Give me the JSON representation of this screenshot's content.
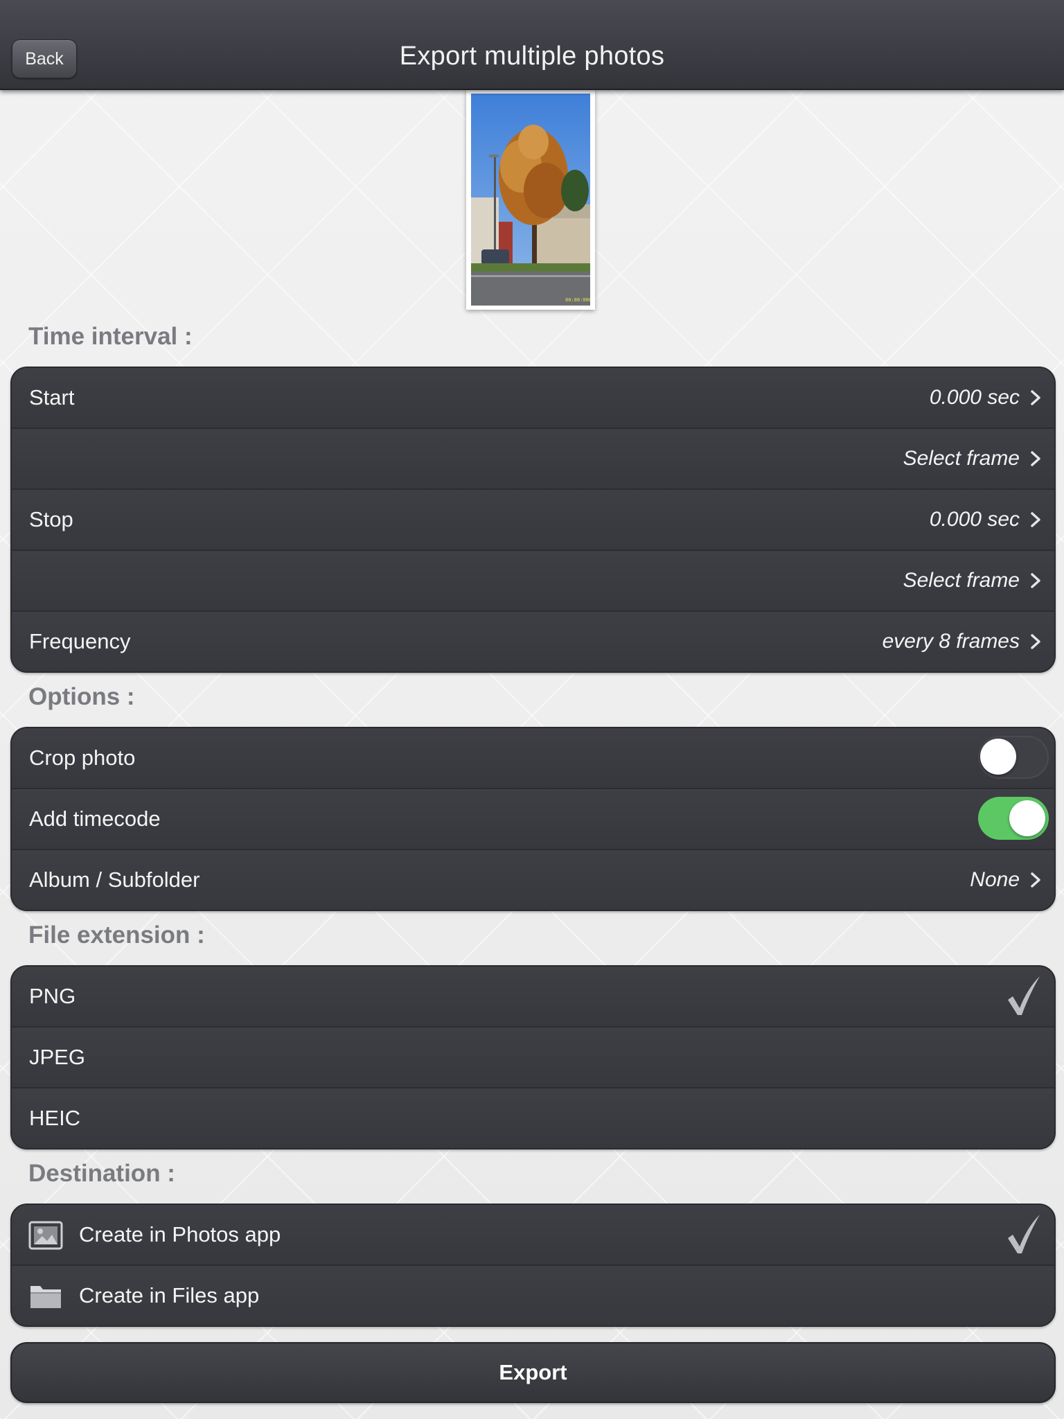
{
  "header": {
    "title": "Export multiple photos",
    "back_label": "Back"
  },
  "sections": {
    "time_interval": "Time interval :",
    "options": "Options :",
    "file_extension": "File extension :",
    "destination": "Destination :"
  },
  "time_interval": {
    "start_label": "Start",
    "start_value": "0.000 sec",
    "start_frame": "Select frame",
    "stop_label": "Stop",
    "stop_value": "0.000 sec",
    "stop_frame": "Select frame",
    "frequency_label": "Frequency",
    "frequency_value": "every 8 frames"
  },
  "options": {
    "crop_label": "Crop photo",
    "crop_on": false,
    "timecode_label": "Add timecode",
    "timecode_on": true,
    "album_label": "Album / Subfolder",
    "album_value": "None"
  },
  "file_extension": {
    "items": [
      "PNG",
      "JPEG",
      "HEIC"
    ],
    "selected": "PNG"
  },
  "destination": {
    "photos_label": "Create in Photos app",
    "files_label": "Create in Files app",
    "selected": "photos"
  },
  "export_label": "Export",
  "colors": {
    "toggle_on": "#5cc864",
    "row_bg": "#3a3b41",
    "section_header": "#7a7b80"
  }
}
